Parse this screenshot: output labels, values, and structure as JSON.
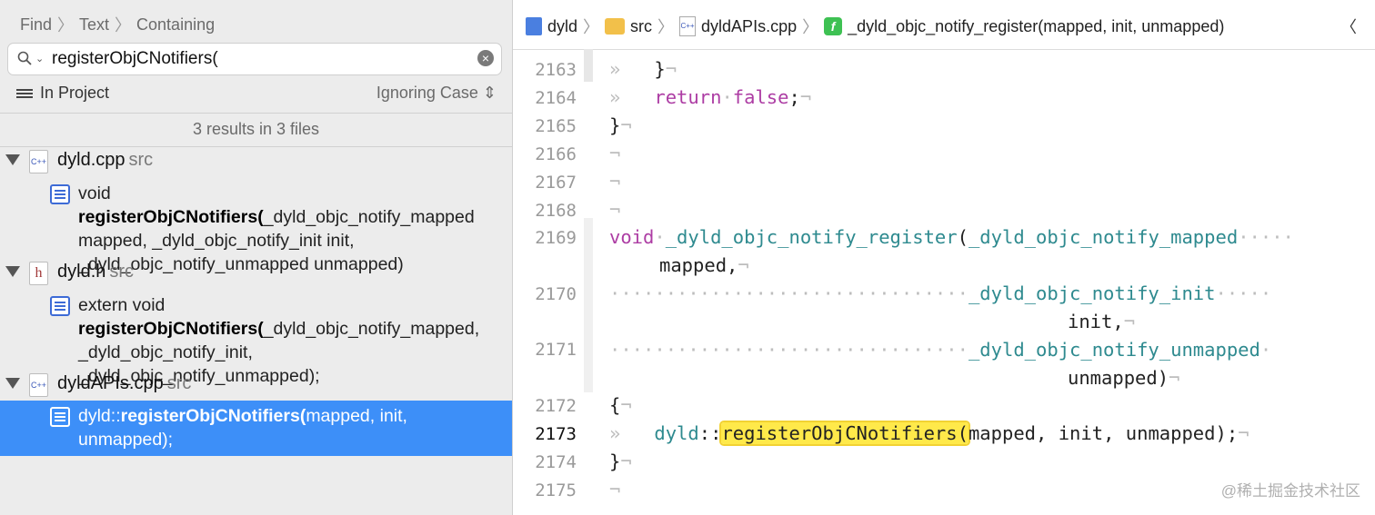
{
  "navigator": {
    "breadcrumb": [
      "Find",
      "Text",
      "Containing"
    ],
    "search": {
      "value": "registerObjCNotifiers("
    },
    "scope_label": "In Project",
    "case_label": "Ignoring Case",
    "results_summary": "3 results in 3 files",
    "files": [
      {
        "name": "dyld.cpp",
        "dir": "src",
        "type": "C++",
        "match": {
          "pre": "void ",
          "term": "registerObjCNotifiers(",
          "post": "_dyld_objc_notify_mapped mapped, _dyld_objc_notify_init init, _dyld_objc_notify_unmapped unmapped)"
        }
      },
      {
        "name": "dyld.h",
        "dir": "src",
        "type": "h",
        "match": {
          "pre": "extern void",
          "term": "registerObjCNotifiers(",
          "post": "_dyld_objc_notify_mapped, _dyld_objc_notify_init, _dyld_objc_notify_unmapped);"
        }
      },
      {
        "name": "dyldAPIs.cpp",
        "dir": "src",
        "type": "C++",
        "match": {
          "pre": "dyld::",
          "term": "registerObjCNotifiers(",
          "post": "mapped, init, unmapped);"
        }
      }
    ]
  },
  "editor": {
    "jump_bar": [
      "dyld",
      "src",
      "dyldAPIs.cpp",
      "_dyld_objc_notify_register(mapped, init, unmapped)"
    ],
    "func_icon": "f",
    "line_numbers": [
      "2163",
      "2164",
      "2165",
      "2166",
      "2167",
      "2168",
      "2169",
      "2170",
      "2171",
      "2172",
      "2173",
      "2174",
      "2175"
    ],
    "current_line": "2173",
    "code": {
      "l2163": "}",
      "l2164_kw1": "return",
      "l2164_kw2": "false",
      "l2164_end": ";",
      "l2165": "}",
      "l2169_kw": "void",
      "l2169_fn": "_dyld_objc_notify_register",
      "l2169_paren": "(",
      "l2169_type": "_dyld_objc_notify_mapped",
      "l2169_cont": "mapped,",
      "l2170_type": "_dyld_objc_notify_init",
      "l2170_cont": "init,",
      "l2171_type": "_dyld_objc_notify_unmapped",
      "l2171_cont": "unmapped)",
      "l2172": "{",
      "l2173_ns": "dyld",
      "l2173_sep": "::",
      "l2173_hl": "registerObjCNotifiers(",
      "l2173_rest": "mapped, init, unmapped);",
      "l2174": "}"
    },
    "watermark": "@稀土掘金技术社区"
  }
}
